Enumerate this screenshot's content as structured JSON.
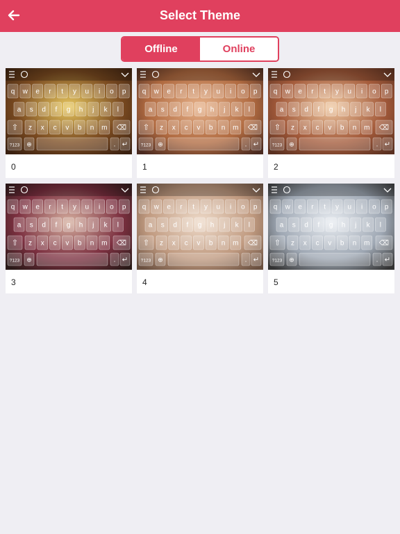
{
  "header": {
    "title": "Select Theme"
  },
  "segments": {
    "offline": "Offline",
    "online": "Online",
    "selected": "Offline"
  },
  "keyboard": {
    "row1": [
      "q",
      "w",
      "e",
      "r",
      "t",
      "y",
      "u",
      "i",
      "o",
      "p"
    ],
    "row2": [
      "a",
      "s",
      "d",
      "f",
      "g",
      "h",
      "j",
      "k",
      "l"
    ],
    "row3": [
      "z",
      "x",
      "c",
      "v",
      "b",
      "n",
      "m"
    ],
    "numkey": "?123",
    "dot": "."
  },
  "themes": [
    {
      "label": "0",
      "colors": [
        "#e8c860",
        "#7a4a20",
        "#3a2010"
      ]
    },
    {
      "label": "1",
      "colors": [
        "#e7b28a",
        "#b06a40",
        "#4a2a20"
      ]
    },
    {
      "label": "2",
      "colors": [
        "#f0c9a2",
        "#a35a3a",
        "#5a3020"
      ]
    },
    {
      "label": "3",
      "colors": [
        "#d6b0a0",
        "#7c3040",
        "#2a1a18"
      ]
    },
    {
      "label": "4",
      "colors": [
        "#efdccb",
        "#c09a80",
        "#6a5040"
      ]
    },
    {
      "label": "5",
      "colors": [
        "#e9edf2",
        "#9ea7b3",
        "#333333"
      ]
    }
  ]
}
